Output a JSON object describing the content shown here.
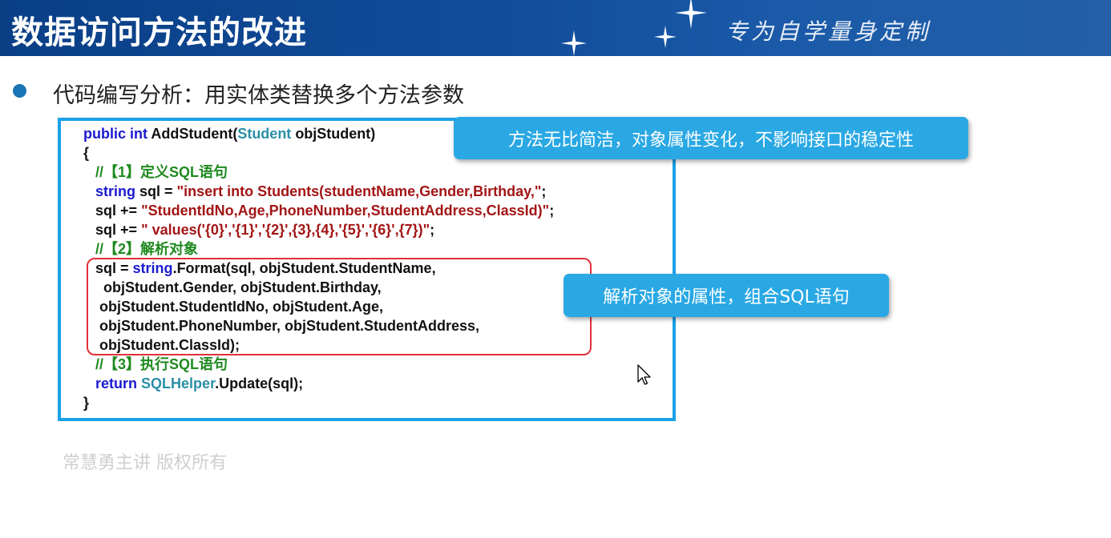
{
  "header": {
    "title": "数据访问方法的改进",
    "slogan": "专为自学量身定制"
  },
  "bullet": {
    "text": "代码编写分析：用实体类替换多个方法参数"
  },
  "code": {
    "signature": {
      "kw": "public int",
      "name": " AddStudent(",
      "type": "Student",
      "param": " objStudent)"
    },
    "open_brace": "{",
    "comment1": "//【1】定义SQL语句",
    "line_sql1": {
      "kw": "string",
      "code": " sql = ",
      "str": "\"insert into Students(studentName,Gender,Birthday,\"",
      "end": ";"
    },
    "line_sql2": {
      "code": "sql += ",
      "str": "\"StudentIdNo,Age,PhoneNumber,StudentAddress,ClassId)\"",
      "end": ";"
    },
    "line_sql3": {
      "code": "sql += ",
      "str": "\" values('{0}','{1}','{2}',{3},{4},'{5}','{6}',{7})\"",
      "end": ";"
    },
    "comment2": "//【2】解析对象",
    "format_line1": {
      "code": "sql = ",
      "kw": "string",
      "rest": ".Format(sql, objStudent.StudentName,"
    },
    "format_line2": "objStudent.Gender, objStudent.Birthday,",
    "format_line3": "objStudent.StudentIdNo, objStudent.Age,",
    "format_line4": "objStudent.PhoneNumber, objStudent.StudentAddress,",
    "format_line5": "objStudent.ClassId);",
    "comment3": "//【3】执行SQL语句",
    "return_line": {
      "kw": "return",
      "type": "SQLHelper",
      "rest": ".Update(sql);"
    },
    "close_brace": "}"
  },
  "callouts": {
    "first": "方法无比简洁，对象属性变化，不影响接口的稳定性",
    "second": "解析对象的属性，组合SQL语句"
  },
  "footer": {
    "text": "常慧勇主讲    版权所有"
  },
  "colors": {
    "header_bg": "#0a3f86",
    "code_border": "#1ba1e6",
    "callout_bg": "#29a8e4",
    "highlight_border": "#e0303a",
    "keyword": "#1a1ad0",
    "type": "#2a8fa6",
    "string": "#a31515",
    "comment": "#1f8a1f"
  },
  "icons": [
    "star-icon",
    "bullet-dot-icon",
    "mouse-cursor-icon"
  ]
}
